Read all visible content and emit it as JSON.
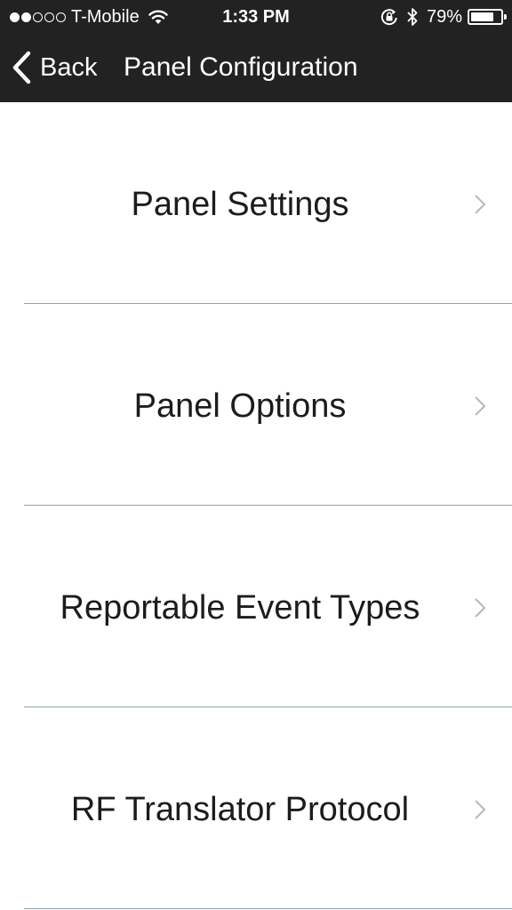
{
  "status_bar": {
    "signal_filled": 2,
    "signal_total": 5,
    "carrier": "T-Mobile",
    "time": "1:33 PM",
    "battery_percent_text": "79%",
    "battery_level": 0.79,
    "icons": [
      "signal-dots",
      "wifi-icon",
      "rotation-lock-icon",
      "bluetooth-icon",
      "battery-icon"
    ]
  },
  "nav": {
    "back_label": "Back",
    "title": "Panel Configuration",
    "back_icon": "chevron-left-icon"
  },
  "menu": {
    "items": [
      {
        "label": "Panel Settings"
      },
      {
        "label": "Panel Options"
      },
      {
        "label": "Reportable Event Types"
      },
      {
        "label": "RF Translator Protocol"
      }
    ],
    "item_icon": "chevron-right-icon"
  },
  "colors": {
    "header_bg": "#222222",
    "header_text": "#ffffff",
    "list_bg": "#ffffff",
    "item_text": "#1c1c1c",
    "divider": "#8ea4ad",
    "chevron": "#b8b8b8"
  }
}
